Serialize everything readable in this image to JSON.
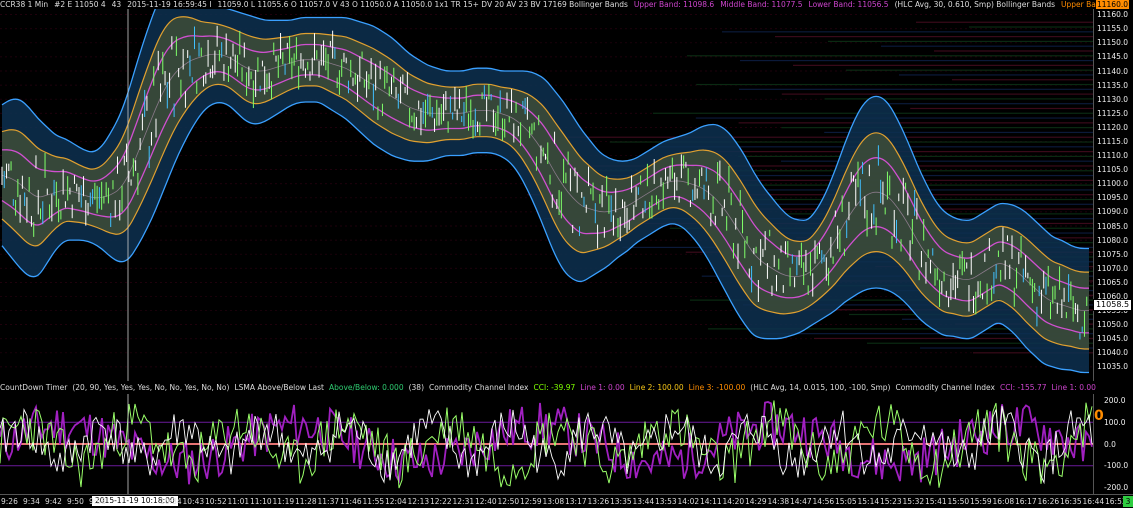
{
  "window": {
    "title_segments": [
      {
        "text": "CCR38 1 Min",
        "color": "#dddddd"
      },
      {
        "text": "#2 E 11050 4",
        "color": "#dddddd"
      },
      {
        "text": "43",
        "color": "#dddddd"
      },
      {
        "text": "2015-11-19 16:59:45 I",
        "color": "#dddddd"
      },
      {
        "text": "11059.0 L 11055.6 O 11057.0 V 43 O 11050.0 A 11050.0 1x1 TR 15+ DV 20 AV 23 BV 17169 Bollinger Bands",
        "color": "#dddddd"
      },
      {
        "text": "Upper Band: 11098.6",
        "color": "#cc44cc"
      },
      {
        "text": "Middle Band: 11077.5",
        "color": "#cc44cc"
      },
      {
        "text": "Lower Band: 11056.5",
        "color": "#cc44cc"
      },
      {
        "text": "(HLC Avg, 30, 0.610, Smp) Bollinger Bands",
        "color": "#dddddd"
      },
      {
        "text": "Upper Band: 11092.4",
        "color": "#ff8c00"
      },
      {
        "text": "Lower Band: 11054.2",
        "color": "#ff8c00"
      },
      {
        "text": "(HL",
        "color": "#dddddd"
      }
    ],
    "top_price_box": "11160.0",
    "last_price_box": "11058.5",
    "corner_label": "3"
  },
  "legend": [
    {
      "text": "CountDown Timer",
      "color": "#dddddd"
    },
    {
      "text": "(20, 90, Yes, Yes, Yes, No, No, Yes, No, No)",
      "color": "#dddddd"
    },
    {
      "text": "LSMA Above/Below Last",
      "color": "#dddddd"
    },
    {
      "text": "Above/Below: 0.000",
      "color": "#2ecc71"
    },
    {
      "text": "(38)",
      "color": "#dddddd"
    },
    {
      "text": "Commodity Channel Index",
      "color": "#dddddd"
    },
    {
      "text": "CCI: -39.97",
      "color": "#7fff00"
    },
    {
      "text": "Line 1: 0.00",
      "color": "#cc44cc"
    },
    {
      "text": "Line 2: 100.00",
      "color": "#f5c518"
    },
    {
      "text": "Line 3: -100.00",
      "color": "#ff8c00"
    },
    {
      "text": "(HLC Avg, 14, 0.015, 100, -100, Smp)",
      "color": "#dddddd"
    },
    {
      "text": "Commodity Channel Index",
      "color": "#dddddd"
    },
    {
      "text": "CCI: -155.77",
      "color": "#cc44cc"
    },
    {
      "text": "Line 1: 0.00",
      "color": "#cc44cc"
    },
    {
      "text": "Line 2: 100.00",
      "color": "#6a1b9a"
    },
    {
      "text": "Line 3: -100.00",
      "color": "#6a1b9a"
    },
    {
      "text": "(HLC Avg, 50, 0.015, 100, -100",
      "color": "#dddddd"
    }
  ],
  "indicator": {
    "zero_marker": "0"
  },
  "time_axis": {
    "cursor_label": "2015-11-19  10:18:00",
    "ticks": [
      "9:26",
      "9:34",
      "9:42",
      "9:50",
      "9:58",
      "10:34",
      "10:43",
      "10:52",
      "11:01",
      "11:10",
      "11:19",
      "11:28",
      "11:37",
      "11:46",
      "11:55",
      "12:04",
      "12:13",
      "12:22",
      "12:31",
      "12:40",
      "12:50",
      "12:59",
      "13:08",
      "13:17",
      "13:26",
      "13:35",
      "13:44",
      "13:53",
      "14:02",
      "14:11",
      "14:20",
      "14:29",
      "14:38",
      "14:47",
      "14:56",
      "15:05",
      "15:14",
      "15:23",
      "15:32",
      "15:41",
      "15:50",
      "15:59",
      "16:08",
      "16:17",
      "16:26",
      "16:35",
      "16:44",
      "16:53",
      "17:02"
    ]
  },
  "chart_data": [
    {
      "type": "line",
      "name": "price",
      "ylim": [
        11030,
        11162
      ],
      "y_ticks": [
        11035,
        11040,
        11045,
        11050,
        11055,
        11060,
        11065,
        11070,
        11075,
        11080,
        11085,
        11090,
        11095,
        11100,
        11105,
        11110,
        11115,
        11120,
        11125,
        11130,
        11135,
        11140,
        11145,
        11150,
        11155,
        11160
      ],
      "y_tick_labels": [
        "11035.0",
        "11040.0",
        "11045.0",
        "11050.0",
        "11055.0",
        "11060.0",
        "11065.0",
        "11070.0",
        "11075.0",
        "11080.0",
        "11085.0",
        "11090.0",
        "11095.0",
        "11100.0",
        "11105.0",
        "11110.0",
        "11115.0",
        "11120.0",
        "11125.0",
        "11130.0",
        "11135.0",
        "11140.0",
        "11145.0",
        "11150.0",
        "11155.0",
        "11160.0"
      ],
      "x_index_range": [
        0,
        120
      ],
      "middle": [
        11103,
        11102,
        11100,
        11097,
        11095,
        11096,
        11097,
        11098,
        11097,
        11096,
        11095,
        11095,
        11096,
        11098,
        11103,
        11111,
        11119,
        11127,
        11134,
        11139,
        11142,
        11144,
        11145,
        11146,
        11146,
        11145,
        11143,
        11141,
        11140,
        11140,
        11141,
        11142,
        11143,
        11144,
        11144,
        11144,
        11143,
        11142,
        11141,
        11139,
        11137,
        11135,
        11133,
        11131,
        11129,
        11127,
        11126,
        11125,
        11125,
        11125,
        11125,
        11125,
        11126,
        11126,
        11126,
        11125,
        11124,
        11122,
        11119,
        11115,
        11110,
        11104,
        11099,
        11095,
        11092,
        11091,
        11090,
        11090,
        11091,
        11092,
        11094,
        11096,
        11098,
        11100,
        11101,
        11101,
        11100,
        11099,
        11097,
        11094,
        11090,
        11085,
        11080,
        11075,
        11072,
        11070,
        11068,
        11067,
        11067,
        11068,
        11071,
        11075,
        11080,
        11086,
        11091,
        11095,
        11097,
        11097,
        11095,
        11091,
        11086,
        11080,
        11075,
        11071,
        11068,
        11067,
        11066,
        11066,
        11068,
        11070,
        11072,
        11071,
        11069,
        11066,
        11063,
        11060,
        11058,
        11057,
        11056,
        11055,
        11055
      ],
      "upper2_offset": [
        25,
        28,
        30,
        30,
        28,
        24,
        20,
        18,
        17,
        16,
        16,
        18,
        22,
        26,
        30,
        33,
        35,
        36,
        35,
        32,
        28,
        24,
        20,
        18,
        17,
        17,
        18,
        19,
        19,
        18,
        17,
        16,
        15,
        15,
        15,
        15,
        16,
        17,
        18,
        19,
        20,
        21,
        21,
        21,
        20,
        19,
        18,
        17,
        16,
        15,
        15,
        15,
        15,
        15,
        15,
        15,
        16,
        18,
        21,
        24,
        27,
        29,
        30,
        29,
        27,
        24,
        21,
        19,
        17,
        16,
        15,
        15,
        15,
        15,
        15,
        16,
        18,
        21,
        24,
        27,
        29,
        30,
        30,
        29,
        27,
        25,
        23,
        21,
        20,
        19,
        20,
        22,
        25,
        28,
        31,
        33,
        34,
        34,
        33,
        31,
        29,
        27,
        25,
        23,
        22,
        21,
        21,
        21,
        21,
        21,
        21,
        22,
        23,
        24,
        24,
        24,
        23,
        23,
        22,
        22,
        22
      ],
      "inner_ratio": 0.62,
      "pink_ratio": 0.36
    },
    {
      "type": "line",
      "name": "cci",
      "ylim": [
        -230,
        230
      ],
      "y_ticks": [
        200,
        100,
        0,
        -100,
        -200
      ],
      "y_tick_labels": [
        "200.0",
        "100.0",
        "0.0",
        "-100.0",
        "-200.0"
      ],
      "reference_lines": [
        {
          "value": 100,
          "color": "#6a1b9a"
        },
        {
          "value": 0,
          "color": "#e57373"
        },
        {
          "value": -100,
          "color": "#6a1b9a"
        }
      ],
      "series_colors": {
        "cci_fast": "#9aff6a",
        "cci_fast2": "#ffffff",
        "cci_slow": "#a020c0"
      }
    }
  ]
}
